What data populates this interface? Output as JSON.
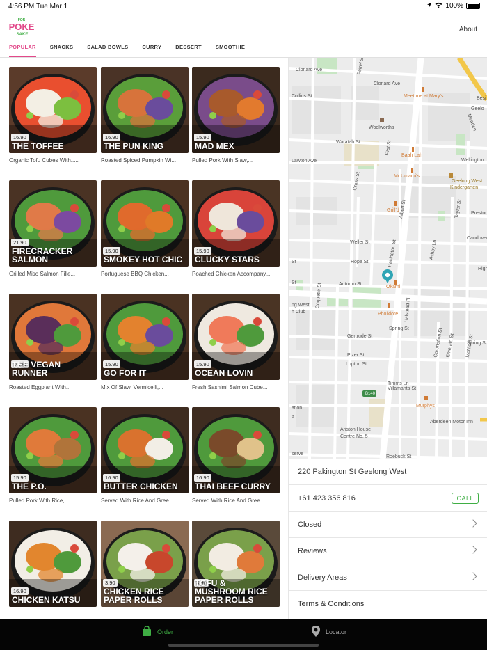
{
  "status_bar": {
    "time": "4:56 PM",
    "date": "Tue Mar 1",
    "battery": "100%"
  },
  "header": {
    "logo": {
      "top": "FOR",
      "main": "POKE",
      "bottom": "SAKE!"
    },
    "about_label": "About"
  },
  "tabs": [
    {
      "label": "POPULAR",
      "active": true
    },
    {
      "label": "SNACKS",
      "active": false
    },
    {
      "label": "SALAD BOWLS",
      "active": false
    },
    {
      "label": "CURRY",
      "active": false
    },
    {
      "label": "DESSERT",
      "active": false
    },
    {
      "label": "SMOOTHIE",
      "active": false
    }
  ],
  "menu_items": [
    {
      "price": "16.90",
      "name": "THE TOFFEE",
      "desc": "Organic Tofu Cubes With.....",
      "colors": [
        "#5b3b2a",
        "#f3efe4",
        "#7cbf3f",
        "#e94f2f"
      ]
    },
    {
      "price": "16.90",
      "name": "THE PUN KING",
      "desc": "Roasted Spiced Pumpkin Wi...",
      "colors": [
        "#4a3326",
        "#d7733b",
        "#6a4c9c",
        "#5a9e3a"
      ]
    },
    {
      "price": "15.90",
      "name": "MAD MEX",
      "desc": "Pulled Pork With Slaw,...",
      "colors": [
        "#3b2a1e",
        "#a85a2c",
        "#e27a2e",
        "#7a4c8a"
      ]
    },
    {
      "price": "21.90",
      "name": "FIRECRACKER SALMON",
      "desc": "Grilled Miso Salmon Fille...",
      "colors": [
        "#4a3324",
        "#e07a48",
        "#7c4aa0",
        "#4f9a3c"
      ]
    },
    {
      "price": "15.90",
      "name": "SMOKEY HOT CHIC",
      "desc": "Portuguese BBQ Chicken...",
      "colors": [
        "#4b3222",
        "#e06a2c",
        "#e07a28",
        "#4f9a3c"
      ]
    },
    {
      "price": "15.90",
      "name": "CLUCKY STARS",
      "desc": "Poached Chicken Accompany...",
      "colors": [
        "#4a3424",
        "#efe6da",
        "#6a4c9c",
        "#d9443a"
      ]
    },
    {
      "price": "16.90",
      "name": "THE VEGAN RUNNER",
      "desc": "Roasted Eggplant With...",
      "colors": [
        "#4a3222",
        "#5a2e5a",
        "#4f9a3c",
        "#e0783a"
      ]
    },
    {
      "price": "15.90",
      "name": "GO FOR IT",
      "desc": "Mix Of Slaw, Vermicelli,...",
      "colors": [
        "#4a3222",
        "#e3822e",
        "#6a4c9c",
        "#4f9a3c"
      ]
    },
    {
      "price": "15.90",
      "name": "OCEAN LOVIN",
      "desc": "Fresh Sashimi Salmon Cube...",
      "colors": [
        "#4a3424",
        "#f07a5a",
        "#4f9a3c",
        "#efe9e0"
      ]
    },
    {
      "price": "15.90",
      "name": "THE P.O.",
      "desc": "Pulled Pork With Rice,...",
      "colors": [
        "#4a3222",
        "#e07a3a",
        "#b0743a",
        "#4f9a3c"
      ]
    },
    {
      "price": "16.90",
      "name": "BUTTER CHICKEN",
      "desc": "Served With Rice And Gree...",
      "colors": [
        "#3e2c20",
        "#d9722e",
        "#f2eee6",
        "#4f9a3c"
      ]
    },
    {
      "price": "16.90",
      "name": "THAI BEEF CURRY",
      "desc": "Served With Rice And Gree...",
      "colors": [
        "#3e2c20",
        "#7a4a2a",
        "#e0c28a",
        "#4f9a3c"
      ]
    },
    {
      "price": "16.90",
      "name": "CHICKEN KATSU",
      "desc": "",
      "colors": [
        "#3e2c20",
        "#e2862e",
        "#4f9a3c",
        "#f2eee6"
      ]
    },
    {
      "price": "3.90",
      "name": "CHICKEN RICE PAPER ROLLS",
      "desc": "",
      "colors": [
        "#8a6a52",
        "#f4f0ea",
        "#c8472c",
        "#7aa04a"
      ]
    },
    {
      "price": "3.90",
      "name": "TOFU & MUSHROOM RICE PAPER ROLLS",
      "desc": "",
      "colors": [
        "#5a4a3a",
        "#f2ece2",
        "#e07a3a",
        "#7aa04a"
      ]
    }
  ],
  "map": {
    "streets": [
      "Clonard Ave",
      "Clonard Ave",
      "Collins St",
      "Waratah St",
      "Lawton Ave",
      "Wellington",
      "Preston",
      "Candover",
      "Hope St",
      "Weller St",
      "Autumn St",
      "Spring St",
      "Spring St",
      "Gertrude St",
      "Pizer St",
      "Lupton St",
      "Villamanta St",
      "Timms Ln",
      "Roebuck St",
      "Pakington St",
      "Petrel St",
      "First St",
      "Cross St",
      "Albert St",
      "Coquette St",
      "Halstead Pl",
      "Coronation St",
      "Emerald St",
      "McNicol St",
      "Tayler St",
      "Ashby Ln",
      "Madden",
      "Besi",
      "Geelo",
      "High",
      "St",
      "St",
      "ng West",
      "h Club",
      "ation",
      "a",
      "serve"
    ],
    "pois": [
      "Meet me at Mary's",
      "Woolworths",
      "Baah Lah",
      "Mr Umami's",
      "Geelong West",
      "Kindergarten",
      "Grill'd",
      "Okami",
      "Pholklore",
      "Murphys",
      "Aberdeen Motor Inn",
      "Ariston House",
      "Centre No. 5",
      "B140"
    ]
  },
  "info": {
    "address": "220 Pakington St Geelong West",
    "phone": "+61 423 356 816",
    "call_label": "CALL",
    "rows": [
      "Closed",
      "Reviews",
      "Delivery Areas",
      "Terms & Conditions"
    ]
  },
  "bottom_nav": [
    {
      "label": "Order",
      "active": true
    },
    {
      "label": "Locator",
      "active": false
    }
  ],
  "colors": {
    "accent": "#e2498a",
    "green": "#3fae44",
    "bottom_bar": "#050505"
  }
}
